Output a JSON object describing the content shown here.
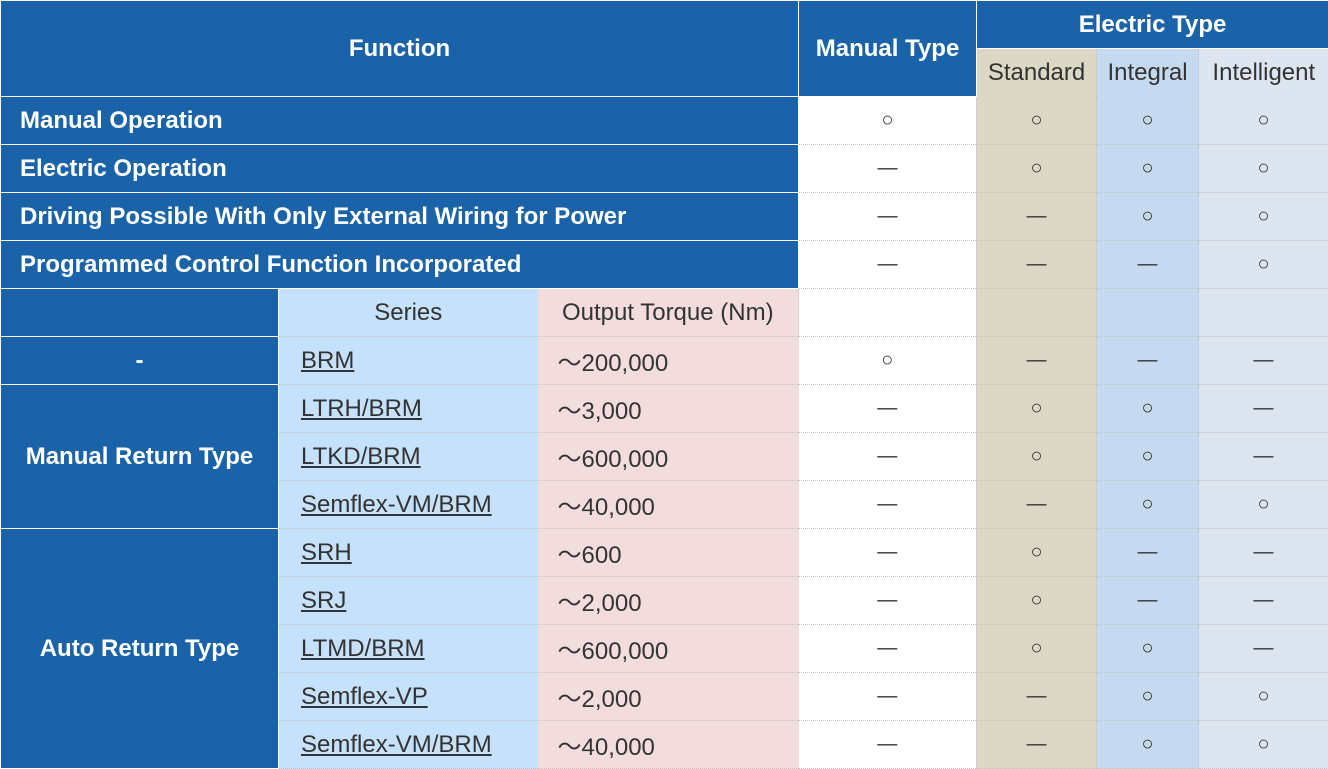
{
  "headers": {
    "function": "Function",
    "manual_type": "Manual Type",
    "electric_type": "Electric Type",
    "standard": "Standard",
    "integral": "Integral",
    "intelligent": "Intelligent",
    "series": "Series",
    "output_torque": "Output Torque (Nm)"
  },
  "functions": [
    {
      "label": "Manual Operation",
      "manual": "○",
      "standard": "○",
      "integral": "○",
      "intelligent": "○"
    },
    {
      "label": "Electric Operation",
      "manual": "—",
      "standard": "○",
      "integral": "○",
      "intelligent": "○"
    },
    {
      "label": "Driving Possible With Only External Wiring for Power",
      "manual": "—",
      "standard": "—",
      "integral": "○",
      "intelligent": "○"
    },
    {
      "label": "Programmed Control Function Incorporated",
      "manual": "—",
      "standard": "—",
      "integral": "—",
      "intelligent": "○"
    }
  ],
  "groups": {
    "none": "-",
    "manual_return": "Manual Return Type",
    "auto_return": "Auto Return Type"
  },
  "rows": [
    {
      "series": "BRM",
      "torque": "～200,000",
      "manual": "○",
      "standard": "—",
      "integral": "—",
      "intelligent": "—"
    },
    {
      "series": "LTRH/BRM",
      "torque": "～3,000",
      "manual": "—",
      "standard": "○",
      "integral": "○",
      "intelligent": "—"
    },
    {
      "series": "LTKD/BRM",
      "torque": "～600,000",
      "manual": "—",
      "standard": "○",
      "integral": "○",
      "intelligent": "—"
    },
    {
      "series": "Semflex-VM/BRM",
      "torque": "～40,000",
      "manual": "—",
      "standard": "—",
      "integral": "○",
      "intelligent": "○"
    },
    {
      "series": "SRH",
      "torque": "～600",
      "manual": "—",
      "standard": "○",
      "integral": "—",
      "intelligent": "—"
    },
    {
      "series": "SRJ",
      "torque": "～2,000",
      "manual": "—",
      "standard": "○",
      "integral": "—",
      "intelligent": "—"
    },
    {
      "series": "LTMD/BRM",
      "torque": "～600,000",
      "manual": "—",
      "standard": "○",
      "integral": "○",
      "intelligent": "—"
    },
    {
      "series": "Semflex-VP",
      "torque": "～2,000",
      "manual": "—",
      "standard": "—",
      "integral": "○",
      "intelligent": "○"
    },
    {
      "series": "Semflex-VM/BRM",
      "torque": "～40,000",
      "manual": "—",
      "standard": "—",
      "integral": "○",
      "intelligent": "○"
    }
  ],
  "colors": {
    "header_blue": "#1a63a8",
    "standard_bg": "#dcd8c5",
    "integral_bg": "#c5d9f0",
    "intelligent_bg": "#dde6f0",
    "series_bg": "#c6e1fb",
    "torque_bg": "#f2dcdc"
  }
}
